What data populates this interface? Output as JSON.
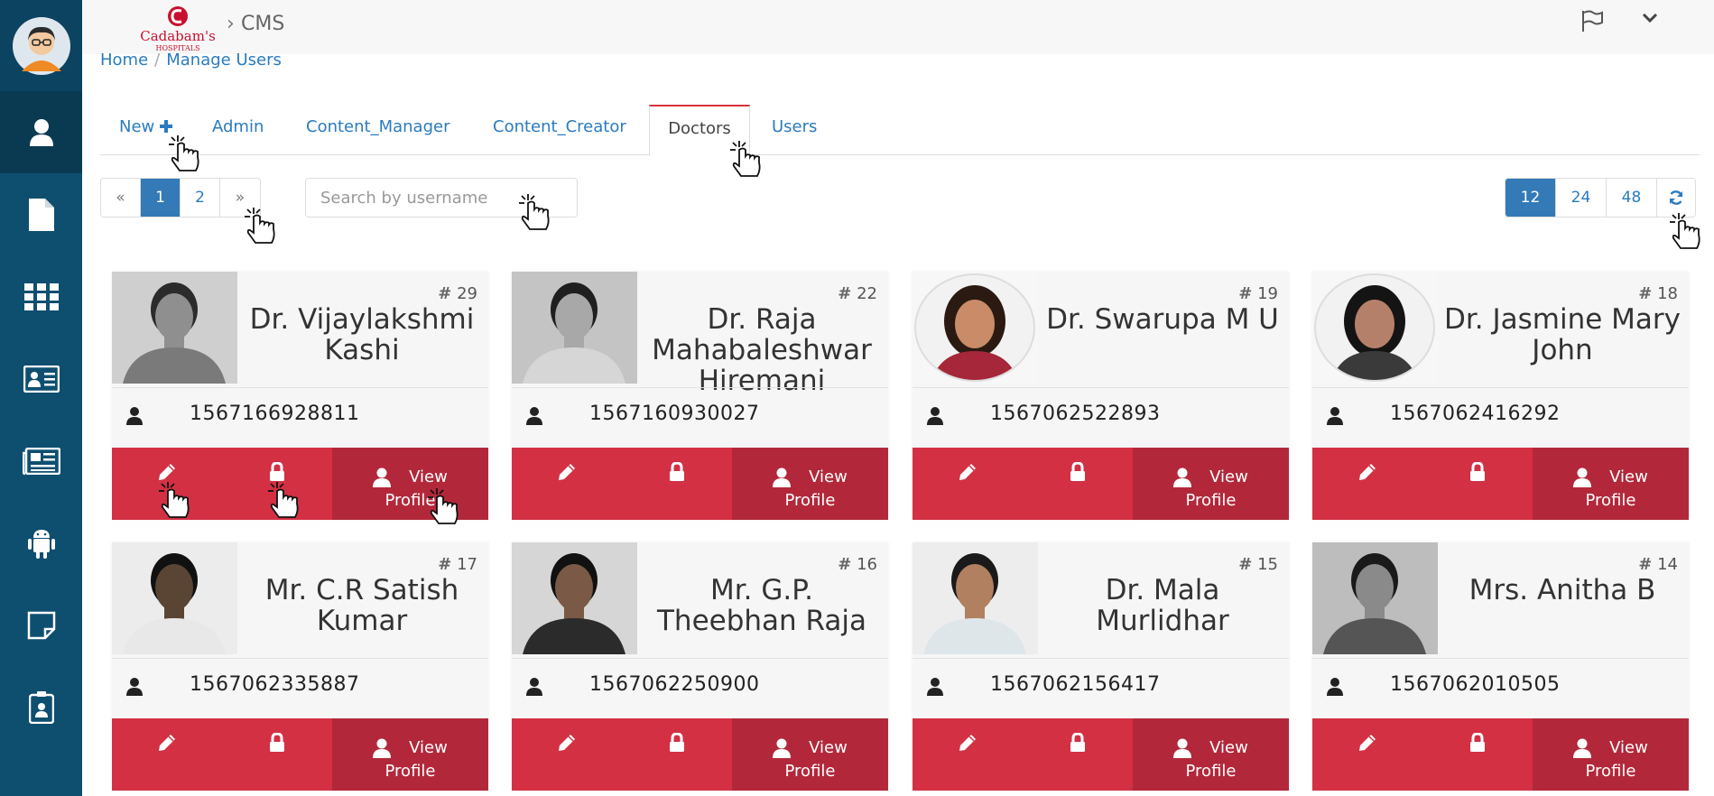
{
  "app": {
    "name": "CMS",
    "logo_text_main": "Cadabam's",
    "logo_text_sub": "HOSPITALS",
    "logo_color": "#c8102e"
  },
  "sidebar": {
    "items": [
      {
        "icon": "user-icon",
        "active": true
      },
      {
        "icon": "file-icon",
        "active": false
      },
      {
        "icon": "grid-icon",
        "active": false
      },
      {
        "icon": "id-card-icon",
        "active": false
      },
      {
        "icon": "newspaper-icon",
        "active": false
      },
      {
        "icon": "android-icon",
        "active": false
      },
      {
        "icon": "sticky-note-icon",
        "active": false
      },
      {
        "icon": "id-badge-icon",
        "active": false
      }
    ]
  },
  "breadcrumb": {
    "home": "Home",
    "current": "Manage Users"
  },
  "tabs": [
    {
      "label": "New"
    },
    {
      "label": "Admin"
    },
    {
      "label": "Content_Manager"
    },
    {
      "label": "Content_Creator"
    },
    {
      "label": "Doctors"
    },
    {
      "label": "Users"
    }
  ],
  "active_tab": "Doctors",
  "pagination": {
    "prev": "«",
    "pages": [
      "1",
      "2"
    ],
    "current": "1",
    "next": "»"
  },
  "search": {
    "placeholder": "Search by username",
    "value": ""
  },
  "page_sizes": {
    "options": [
      "12",
      "24",
      "48"
    ],
    "selected": "12",
    "refresh_icon": "refresh-icon"
  },
  "actions": {
    "view_line1": "View",
    "view_line2": "Profile"
  },
  "colors": {
    "accent": "#337ab7",
    "action": "#d33044",
    "action_dark": "#b2283a",
    "sidebar": "#0e4f70"
  },
  "users": [
    {
      "id": "29",
      "name": "Dr. Vijaylakshmi Kashi",
      "phone": "1567166928811"
    },
    {
      "id": "22",
      "name": "Dr. Raja Mahabaleshwar Hiremani",
      "phone": "1567160930027"
    },
    {
      "id": "19",
      "name": "Dr. Swarupa M U",
      "phone": "1567062522893"
    },
    {
      "id": "18",
      "name": "Dr. Jasmine Mary John",
      "phone": "1567062416292"
    },
    {
      "id": "17",
      "name": "Mr. C.R Satish Kumar",
      "phone": "1567062335887"
    },
    {
      "id": "16",
      "name": "Mr. G.P. Theebhan Raja",
      "phone": "1567062250900"
    },
    {
      "id": "15",
      "name": "Dr. Mala Murlidhar",
      "phone": "1567062156417"
    },
    {
      "id": "14",
      "name": "Mrs. Anitha B",
      "phone": "1567062010505"
    }
  ]
}
